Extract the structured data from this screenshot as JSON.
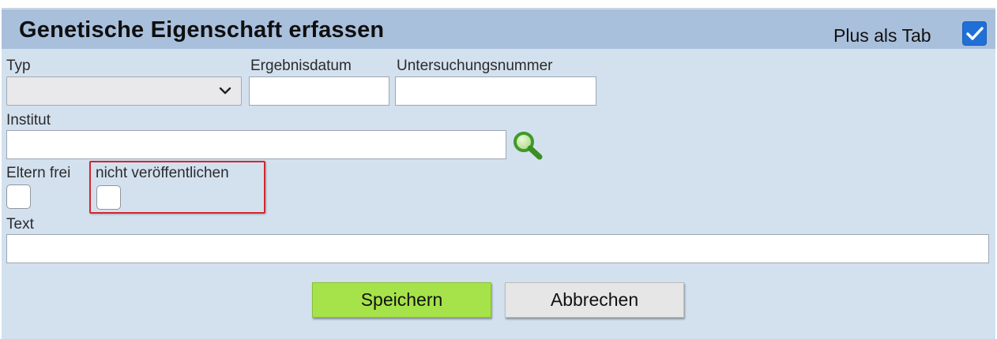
{
  "dialog": {
    "title": "Genetische Eigenschaft erfassen",
    "plus_als_tab": {
      "label": "Plus als Tab",
      "checked": true
    }
  },
  "form": {
    "typ": {
      "label": "Typ",
      "selected_value": ""
    },
    "ergebnisdatum": {
      "label": "Ergebnisdatum",
      "value": ""
    },
    "untersuchungsnummer": {
      "label": "Untersuchungsnummer",
      "value": ""
    },
    "institut": {
      "label": "Institut",
      "value": ""
    },
    "eltern_frei": {
      "label": "Eltern frei",
      "checked": false
    },
    "nicht_veroeffentlichen": {
      "label": "nicht veröffentlichen",
      "checked": false
    },
    "text": {
      "label": "Text",
      "value": ""
    }
  },
  "buttons": {
    "save": "Speichern",
    "cancel": "Abbrechen"
  },
  "icons": {
    "search": "search-icon",
    "dropdown": "chevron-down-icon",
    "checkmark": "checkmark-icon"
  },
  "colors": {
    "panel_bg": "#d3e1ef",
    "header_bg": "#a9c0dc",
    "save_button": "#a6e34a",
    "cancel_button": "#e6e6e6",
    "checkbox_checked": "#1f6fd6",
    "highlight_border": "#d3262e"
  }
}
